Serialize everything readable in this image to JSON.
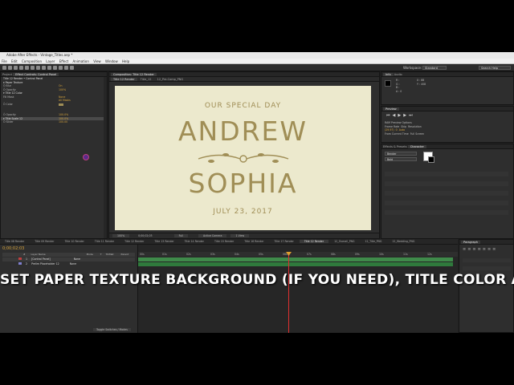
{
  "app": {
    "title": "Adobe After Effects - Vintage_Titles.aep *",
    "menu": [
      "File",
      "Edit",
      "Composition",
      "Layer",
      "Effect",
      "Animation",
      "View",
      "Window",
      "Help"
    ],
    "workspace_label": "Workspace:",
    "workspace_value": "Standard",
    "search_placeholder": "Search Help"
  },
  "left_panel": {
    "tabs": [
      "Project",
      "Effect Controls: Control Panel"
    ],
    "header": "Title 12 Render • Control Panel",
    "rows": [
      {
        "label": "▾ Paper Texture",
        "value": ""
      },
      {
        "label": "   Ö Blur",
        "value": "On"
      },
      {
        "label": "   Ö Opacity",
        "value": "100%"
      },
      {
        "label": "▾ Title 12 Color",
        "value": ""
      },
      {
        "label": "   Fill Mask",
        "value": "None"
      },
      {
        "label": "",
        "value": "All Masks"
      },
      {
        "label": "   Ö Color",
        "value": ""
      },
      {
        "label": "",
        "value": ""
      },
      {
        "label": "",
        "value": ""
      },
      {
        "label": "   Ö Opacity",
        "value": "100.0%"
      },
      {
        "label": "▾ Title Scale 12",
        "value": "100.0%"
      },
      {
        "label": "   Ö Slider",
        "value": "100.00"
      }
    ]
  },
  "composition": {
    "tabs": [
      "Composition: Title 12 Render"
    ],
    "breadcrumb": [
      "Title 12 Render",
      "Title_12",
      "12_Pre-Comp_PNG"
    ],
    "canvas": {
      "line1": "OUR SPECIAL DAY",
      "name1": "ANDREW",
      "name2": "SOPHIA",
      "date": "JULY 23, 2017"
    },
    "zoom": "100%",
    "timecode": "0;00;02;03",
    "resolution": "Full",
    "camera": "Active Camera",
    "views": "1 View"
  },
  "right_panels": {
    "info_tab": "Info",
    "audio_tab": "Audio",
    "info_r": "R :",
    "info_g": "G :",
    "info_b": "B :",
    "info_a": "A : 0",
    "info_x": "X : 88",
    "info_y": "Y : 408",
    "preview_tab": "Preview",
    "ram_preview": "RAM Preview Options",
    "frame_rate": "Frame Rate",
    "skip": "Skip",
    "resolution": "Resolution",
    "fps": "(29.97)",
    "skip_val": "0",
    "res_val": "Auto",
    "from_current": "From Current Time",
    "full_screen": "Full Screen",
    "effects_tab": "Effects & Presets",
    "character_tab": "Character",
    "font": "Bender",
    "font_style": "Bold",
    "paragraph_tab": "Paragraph"
  },
  "timeline": {
    "tabs": [
      "Title 08 Render",
      "Title 09 Render",
      "Title 10 Render",
      "Title 11 Render",
      "Title 12 Render",
      "Title 13 Render",
      "Title 14 Render",
      "Title 15 Render",
      "Title 16 Render",
      "Title 17 Render",
      "Title 12 Render",
      "12_Overall_PNG",
      "12_Title_PNG",
      "12_Wedding_PNG"
    ],
    "timecode": "0;00;02;03",
    "columns": [
      "#",
      "Layer Name",
      "Mode",
      "T",
      "TrkMat",
      "Parent"
    ],
    "layers": [
      {
        "num": "1",
        "name": "[Control Panel]",
        "mode": "None"
      },
      {
        "num": "2",
        "name": "Prelim Placeholder 12",
        "mode": "None"
      }
    ],
    "ruler": [
      "00s",
      "01s",
      "02s",
      "03s",
      "04s",
      "05s",
      "06s",
      "07s",
      "08s",
      "09s",
      "10s",
      "11s",
      "12s"
    ],
    "toggle": "Toggle Switches / Modes"
  },
  "caption": "SET PAPER TEXTURE BACKGROUND (IF YOU NEED), TITLE COLOR AND SCALE",
  "colors": {
    "accent": "#d4a23a",
    "canvas": "#ece9cd",
    "ink": "#a08e56",
    "bar": "#3f8a4a",
    "cti": "#e03030"
  }
}
